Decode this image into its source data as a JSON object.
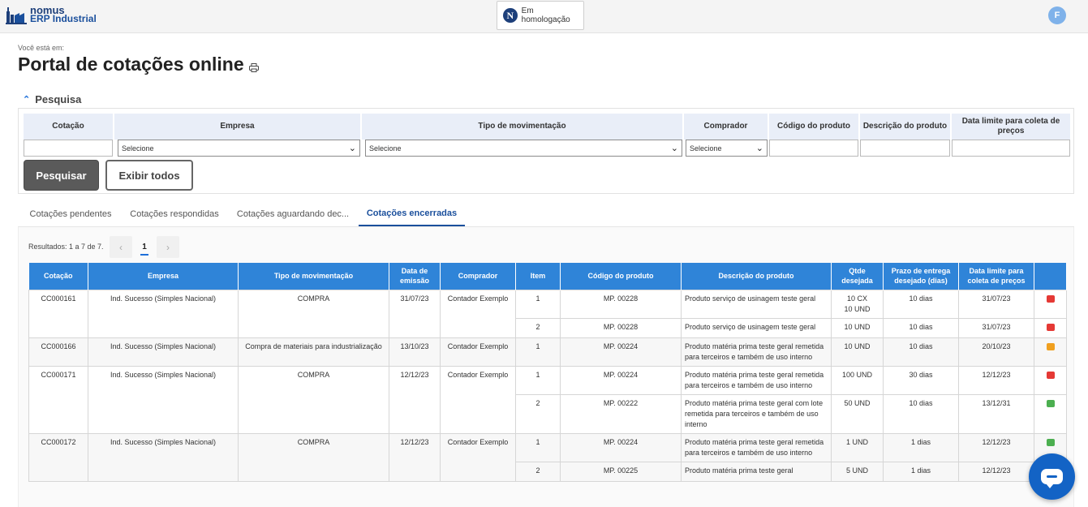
{
  "header": {
    "logo_line1": "nomus",
    "logo_line2": "ERP Industrial",
    "env_badge_text": "Em homologação",
    "env_badge_logo": "N",
    "avatar_initial": "F"
  },
  "breadcrumb": "Você está em:",
  "page_title": "Portal de cotações online",
  "search": {
    "section_title": "Pesquisa",
    "fields": [
      {
        "label": "Cotação",
        "value": ""
      },
      {
        "label": "Empresa",
        "value": "Selecione"
      },
      {
        "label": "Tipo de movimentação",
        "value": "Selecione"
      },
      {
        "label": "Comprador",
        "value": "Selecione"
      },
      {
        "label": "Código do produto",
        "value": ""
      },
      {
        "label": "Descrição do produto",
        "value": ""
      },
      {
        "label": "Data limite para coleta de preços",
        "value": ""
      }
    ],
    "search_button": "Pesquisar",
    "show_all_button": "Exibir todos"
  },
  "tabs": [
    "Cotações pendentes",
    "Cotações respondidas",
    "Cotações aguardando dec...",
    "Cotações encerradas"
  ],
  "active_tab": "Cotações encerradas",
  "results": {
    "count_text": "Resultados: 1 a 7 de 7.",
    "prev": "‹",
    "page": "1",
    "next": "›"
  },
  "table": {
    "headers": [
      "Cotação",
      "Empresa",
      "Tipo de movimentação",
      "Data de emissão",
      "Comprador",
      "Item",
      "Código do produto",
      "Descrição do produto",
      "Qtde desejada",
      "Prazo de entrega desejado (dias)",
      "Data limite para coleta de preços",
      ""
    ],
    "groups": [
      {
        "cotacao": "CC000161",
        "empresa": "Ind. Sucesso (Simples Nacional)",
        "tipo": "COMPRA",
        "data": "31/07/23",
        "comprador": "Contador Exemplo",
        "items": [
          {
            "item": "1",
            "codigo": "MP. 00228",
            "descricao": "Produto serviço de usinagem teste geral",
            "qtde": "10 CX\n10 UND",
            "prazo": "10 dias",
            "limite": "31/07/23",
            "status": "#e53935"
          },
          {
            "item": "2",
            "codigo": "MP. 00228",
            "descricao": "Produto serviço de usinagem teste geral",
            "qtde": "10 UND",
            "prazo": "10 dias",
            "limite": "31/07/23",
            "status": "#e53935"
          }
        ]
      },
      {
        "cotacao": "CC000166",
        "empresa": "Ind. Sucesso (Simples Nacional)",
        "tipo": "Compra de materiais para industrialização",
        "data": "13/10/23",
        "comprador": "Contador Exemplo",
        "items": [
          {
            "item": "1",
            "codigo": "MP. 00224",
            "descricao": "Produto matéria prima teste geral remetida para terceiros e também de uso interno",
            "qtde": "10 UND",
            "prazo": "10 dias",
            "limite": "20/10/23",
            "status": "#f0a020"
          }
        ]
      },
      {
        "cotacao": "CC000171",
        "empresa": "Ind. Sucesso (Simples Nacional)",
        "tipo": "COMPRA",
        "data": "12/12/23",
        "comprador": "Contador Exemplo",
        "items": [
          {
            "item": "1",
            "codigo": "MP. 00224",
            "descricao": "Produto matéria prima teste geral remetida para terceiros e também de uso interno",
            "qtde": "100 UND",
            "prazo": "30 dias",
            "limite": "12/12/23",
            "status": "#e53935"
          },
          {
            "item": "2",
            "codigo": "MP. 00222",
            "descricao": "Produto matéria prima teste geral com lote remetida para terceiros e também de uso interno",
            "qtde": "50 UND",
            "prazo": "10 dias",
            "limite": "13/12/31",
            "status": "#4caf50"
          }
        ]
      },
      {
        "cotacao": "CC000172",
        "empresa": "Ind. Sucesso (Simples Nacional)",
        "tipo": "COMPRA",
        "data": "12/12/23",
        "comprador": "Contador Exemplo",
        "items": [
          {
            "item": "1",
            "codigo": "MP. 00224",
            "descricao": "Produto matéria prima teste geral remetida para terceiros e também de uso interno",
            "qtde": "1 UND",
            "prazo": "1 dias",
            "limite": "12/12/23",
            "status": "#4caf50"
          },
          {
            "item": "2",
            "codigo": "MP. 00225",
            "descricao": "Produto matéria prima teste geral",
            "qtde": "5 UND",
            "prazo": "1 dias",
            "limite": "12/12/23",
            "status": "#4caf50"
          }
        ]
      }
    ]
  },
  "colors": {
    "brand": "#1a4f9c",
    "table_header": "#2f84d8",
    "status_red": "#e53935",
    "status_orange": "#f0a020",
    "status_green": "#4caf50",
    "chat_button": "#1363c5"
  },
  "icons": {
    "logo": "factory-icon",
    "print": "printer-icon",
    "collapse": "chevron-up-icon",
    "chat": "chat-bubble-icon"
  }
}
